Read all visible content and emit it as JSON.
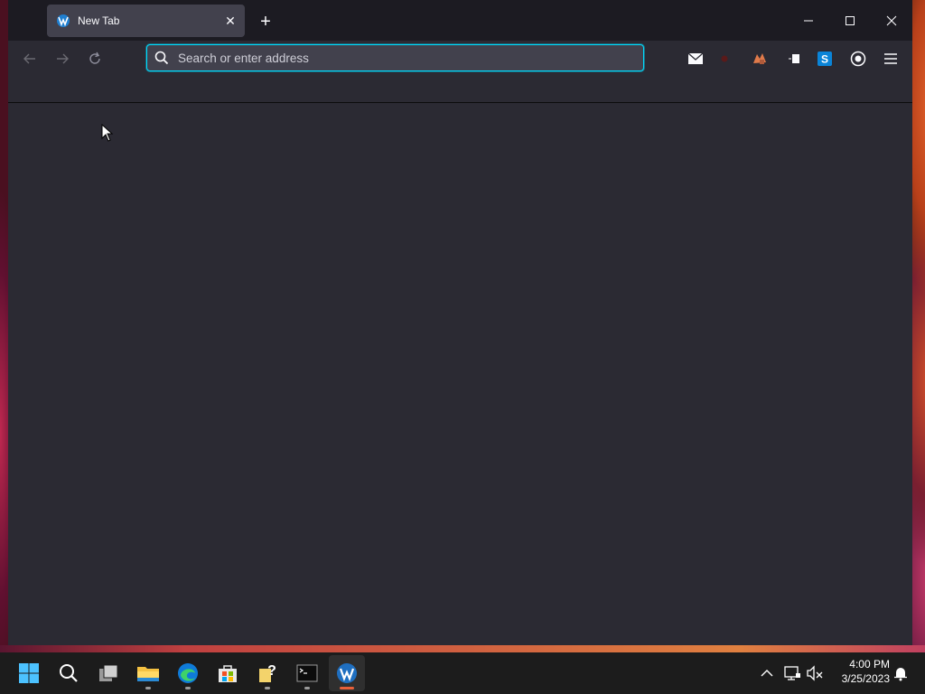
{
  "browser": {
    "tab": {
      "title": "New Tab",
      "close_label": "✕"
    },
    "new_tab_label": "+",
    "url_placeholder": "Search or enter address",
    "url_value": ""
  },
  "taskbar": {
    "apps": [
      "start",
      "search",
      "task-view",
      "file-explorer",
      "edge",
      "store",
      "help-app",
      "terminal",
      "waterfox"
    ],
    "clock": {
      "time": "4:00 PM",
      "date": "3/25/2023"
    }
  },
  "colors": {
    "window_bg": "#2b2a33",
    "titlebar_bg": "#1c1b22",
    "urlbar_focus": "#00ddff",
    "taskbar_bg": "#1c1c1c",
    "active_indicator": "#e8603a"
  }
}
